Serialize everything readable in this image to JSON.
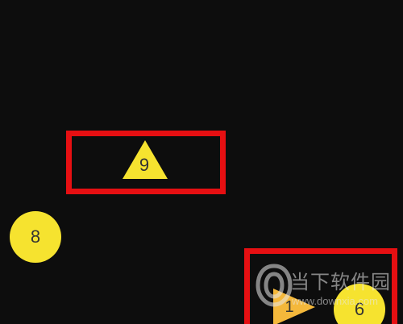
{
  "board": {
    "background": "#0d0d0d",
    "highlight_color": "#e60f12",
    "piece_color": "#f6e32f",
    "triangle_color_alt": "#f4b83b"
  },
  "pieces": {
    "triangle_9": {
      "label": "9",
      "shape": "triangle"
    },
    "circle_8": {
      "label": "8",
      "shape": "circle"
    },
    "triangle_1": {
      "label": "1",
      "shape": "triangle"
    },
    "circle_6": {
      "label": "6",
      "shape": "circle"
    }
  },
  "watermark": {
    "title": "当下软件园",
    "url": "www.downxia.com"
  }
}
